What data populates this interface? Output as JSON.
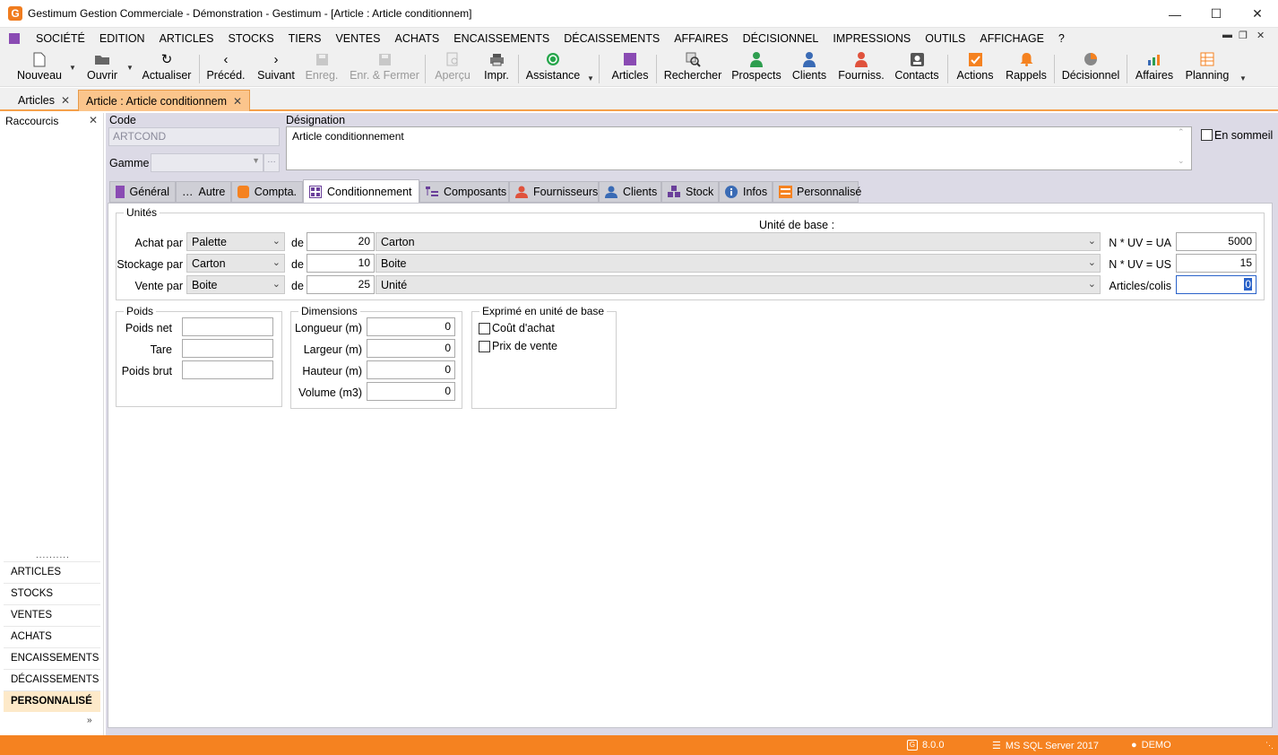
{
  "window": {
    "title": "Gestimum Gestion Commerciale - Démonstration - Gestimum - [Article : Article conditionnem]",
    "app_icon_letter": "G"
  },
  "menu": [
    "SOCIÉTÉ",
    "EDITION",
    "ARTICLES",
    "STOCKS",
    "TIERS",
    "VENTES",
    "ACHATS",
    "ENCAISSEMENTS",
    "DÉCAISSEMENTS",
    "AFFAIRES",
    "DÉCISIONNEL",
    "IMPRESSIONS",
    "OUTILS",
    "AFFICHAGE",
    "?"
  ],
  "toolbar": {
    "nouveau": "Nouveau",
    "ouvrir": "Ouvrir",
    "actualiser": "Actualiser",
    "preced": "Précéd.",
    "suivant": "Suivant",
    "enreg": "Enreg.",
    "enr_fermer": "Enr. & Fermer",
    "apercu": "Aperçu",
    "impr": "Impr.",
    "assistance": "Assistance",
    "articles": "Articles",
    "rechercher": "Rechercher",
    "prospects": "Prospects",
    "clients": "Clients",
    "fourniss": "Fourniss.",
    "contacts": "Contacts",
    "actions": "Actions",
    "rappels": "Rappels",
    "decisionnel": "Décisionnel",
    "affaires": "Affaires",
    "planning": "Planning"
  },
  "doc_tabs": [
    "Articles",
    "Article : Article conditionnem"
  ],
  "sidebar": {
    "header": "Raccourcis",
    "items": [
      "ARTICLES",
      "STOCKS",
      "VENTES",
      "ACHATS",
      "ENCAISSEMENTS",
      "DÉCAISSEMENTS",
      "PERSONNALISÉ"
    ]
  },
  "form": {
    "code_label": "Code",
    "code_value": "ARTCOND",
    "designation_label": "Désignation",
    "designation_value": "Article conditionnement",
    "gamme_label": "Gamme",
    "en_sommeil_label": "En sommeil"
  },
  "form_tabs": [
    "Général",
    "Autre",
    "Compta.",
    "Conditionnement",
    "Composants",
    "Fournisseurs",
    "Clients",
    "Stock",
    "Infos",
    "Personnalisé"
  ],
  "unites": {
    "title": "Unités",
    "unite_base_label": "Unité de base :",
    "de": "de",
    "rows": [
      {
        "label": "Achat par",
        "unit": "Palette",
        "qty": "20",
        "base": "Carton",
        "right_label": "N * UV = UA",
        "right_value": "5000"
      },
      {
        "label": "Stockage par",
        "unit": "Carton",
        "qty": "10",
        "base": "Boite",
        "right_label": "N * UV = US",
        "right_value": "15"
      },
      {
        "label": "Vente par",
        "unit": "Boite",
        "qty": "25",
        "base": "Unité",
        "right_label": "Articles/colis",
        "right_value": "0"
      }
    ]
  },
  "poids": {
    "title": "Poids",
    "labels": [
      "Poids net",
      "Tare",
      "Poids brut"
    ]
  },
  "dimensions": {
    "title": "Dimensions",
    "rows": [
      {
        "label": "Longueur (m)",
        "value": "0"
      },
      {
        "label": "Largeur (m)",
        "value": "0"
      },
      {
        "label": "Hauteur (m)",
        "value": "0"
      },
      {
        "label": "Volume (m3)",
        "value": "0"
      }
    ]
  },
  "exprime": {
    "title": "Exprimé en unité de base",
    "options": [
      "Coût d'achat",
      "Prix de vente"
    ]
  },
  "status": {
    "version": "8.0.0",
    "server": "MS SQL Server 2017",
    "user": "DEMO"
  },
  "colors": {
    "accent": "#f58220",
    "tab_active": "#fbc58c",
    "purple": "#8a4bb3"
  }
}
